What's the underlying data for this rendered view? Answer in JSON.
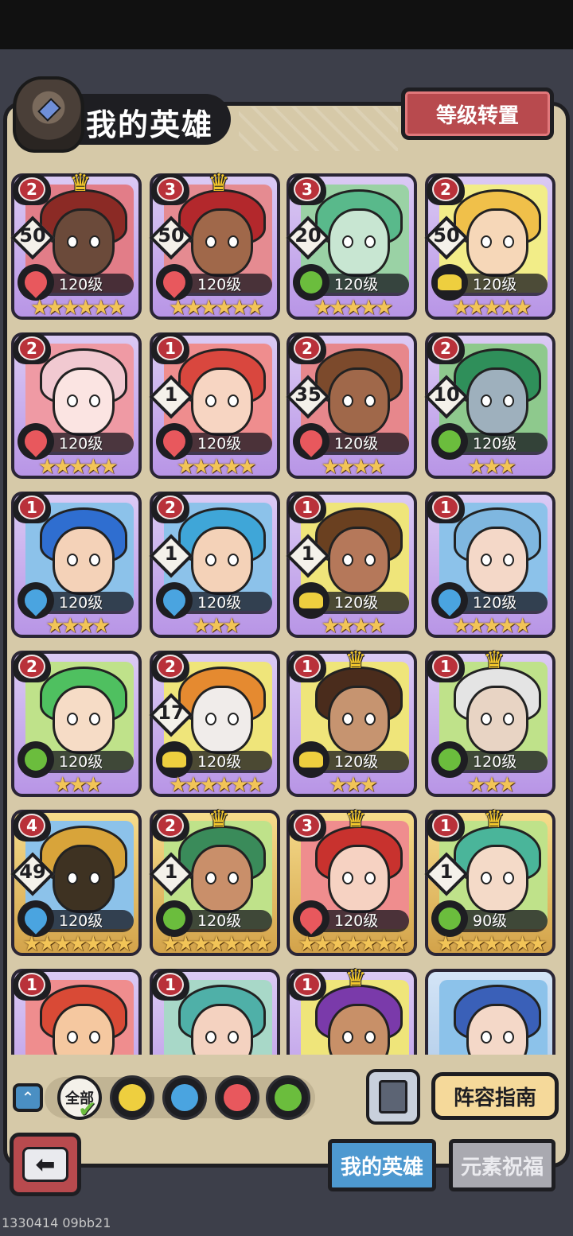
{
  "header": {
    "title": "我的英雄",
    "level_reset": "等级转置"
  },
  "heroes": [
    {
      "rank": "2",
      "crown": true,
      "count": "50",
      "element": "fire",
      "level": "120级",
      "stars": "★★★★★★",
      "frame": "purple",
      "hair": "#8b2a25",
      "skin": "#6b4a3a",
      "bg": "#e27d88"
    },
    {
      "rank": "3",
      "crown": true,
      "count": "50",
      "element": "fire",
      "level": "120级",
      "stars": "★★★★★★",
      "frame": "purple",
      "hair": "#b3282c",
      "skin": "#a0684a",
      "bg": "#e58b91"
    },
    {
      "rank": "3",
      "crown": false,
      "count": "20",
      "element": "wind",
      "level": "120级",
      "stars": "★★★★★",
      "frame": "purple",
      "hair": "#59b98b",
      "skin": "#c8e6d2",
      "bg": "#9ad2a5"
    },
    {
      "rank": "2",
      "crown": false,
      "count": "50",
      "element": "earth",
      "level": "120级",
      "stars": "★★★★★",
      "frame": "purple",
      "hair": "#f0c04a",
      "skin": "#f6d7b8",
      "bg": "#f2ed88"
    },
    {
      "rank": "2",
      "crown": false,
      "count": "",
      "element": "fire",
      "level": "120级",
      "stars": "★★★★★",
      "frame": "purple",
      "hair": "#f1c9d1",
      "skin": "#fbe4e2",
      "bg": "#ef9aa4"
    },
    {
      "rank": "1",
      "crown": false,
      "count": "1",
      "element": "fire",
      "level": "120级",
      "stars": "★★★★★",
      "frame": "purple",
      "hair": "#d9473e",
      "skin": "#f7d5c2",
      "bg": "#ef8d8e"
    },
    {
      "rank": "2",
      "crown": false,
      "count": "35",
      "element": "fire",
      "level": "120级",
      "stars": "★★★★",
      "frame": "purple",
      "hair": "#7c4a2c",
      "skin": "#a0684a",
      "bg": "#e7878c"
    },
    {
      "rank": "2",
      "crown": false,
      "count": "10",
      "element": "wind",
      "level": "120级",
      "stars": "★★★",
      "frame": "purple",
      "hair": "#2f8f5a",
      "skin": "#9eb0bd",
      "bg": "#8ec98d"
    },
    {
      "rank": "1",
      "crown": false,
      "count": "",
      "element": "water",
      "level": "120级",
      "stars": "★★★★",
      "frame": "purple",
      "hair": "#2f6ed0",
      "skin": "#f4d2b8",
      "bg": "#8cc2ea"
    },
    {
      "rank": "2",
      "crown": false,
      "count": "1",
      "element": "water",
      "level": "120级",
      "stars": "★★★",
      "frame": "purple",
      "hair": "#3fa6d8",
      "skin": "#f4d2b8",
      "bg": "#8cc2ea"
    },
    {
      "rank": "1",
      "crown": false,
      "count": "1",
      "element": "earth",
      "level": "120级",
      "stars": "★★★★",
      "frame": "purple",
      "hair": "#6a4020",
      "skin": "#b5785a",
      "bg": "#efe57a"
    },
    {
      "rank": "1",
      "crown": false,
      "count": "",
      "element": "water",
      "level": "120级",
      "stars": "★★★★★",
      "frame": "purple",
      "hair": "#7fb7e0",
      "skin": "#f4d8c8",
      "bg": "#8cc2ea"
    },
    {
      "rank": "2",
      "crown": false,
      "count": "",
      "element": "wind",
      "level": "120级",
      "stars": "★★★",
      "frame": "purple",
      "hair": "#4fc060",
      "skin": "#f6dcc6",
      "bg": "#bfe28a"
    },
    {
      "rank": "2",
      "crown": false,
      "count": "17",
      "element": "earth",
      "level": "120级",
      "stars": "★★★★★★",
      "frame": "purple",
      "hair": "#e58a30",
      "skin": "#f0ecea",
      "bg": "#efe57a"
    },
    {
      "rank": "1",
      "crown": true,
      "count": "",
      "element": "earth",
      "level": "120级",
      "stars": "★★★",
      "frame": "purple",
      "hair": "#4a2c1c",
      "skin": "#c69470",
      "bg": "#efe57a"
    },
    {
      "rank": "1",
      "crown": true,
      "count": "",
      "element": "wind",
      "level": "120级",
      "stars": "★★★",
      "frame": "purple",
      "hair": "#e4e4e4",
      "skin": "#e8d4c4",
      "bg": "#bfe28a"
    },
    {
      "rank": "4",
      "crown": false,
      "count": "49",
      "element": "water",
      "level": "120级",
      "stars": "★★★★★★★",
      "frame": "gold",
      "hair": "#d8a43a",
      "skin": "#3e3222",
      "bg": "#8cc2ea"
    },
    {
      "rank": "2",
      "crown": true,
      "count": "1",
      "element": "wind",
      "level": "120级",
      "stars": "★★★★★★★",
      "frame": "gold",
      "hair": "#3a8b5a",
      "skin": "#c98f6a",
      "bg": "#bfe28a"
    },
    {
      "rank": "3",
      "crown": true,
      "count": "",
      "element": "fire",
      "level": "120级",
      "stars": "★★★★★★★",
      "frame": "gold",
      "hair": "#c8322e",
      "skin": "#f6d2c2",
      "bg": "#ef8d8e"
    },
    {
      "rank": "1",
      "crown": true,
      "count": "1",
      "element": "wind",
      "level": "90级",
      "stars": "★★★★★★★",
      "frame": "gold",
      "hair": "#4ab59a",
      "skin": "#f4dac8",
      "bg": "#bfe28a"
    },
    {
      "rank": "1",
      "crown": false,
      "count": "",
      "element": "fire",
      "level": "",
      "stars": "",
      "frame": "purple",
      "hair": "#d94a36",
      "skin": "#f5c8a0",
      "bg": "#ef8d8e"
    },
    {
      "rank": "1",
      "crown": false,
      "count": "",
      "element": "wind",
      "level": "",
      "stars": "",
      "frame": "purple",
      "hair": "#4fb0a8",
      "skin": "#f4d2c0",
      "bg": "#a8d8c8"
    },
    {
      "rank": "1",
      "crown": true,
      "count": "",
      "element": "earth",
      "level": "",
      "stars": "",
      "frame": "purple",
      "hair": "#7a3aaa",
      "skin": "#c89068",
      "bg": "#efe57a"
    },
    {
      "rank": "",
      "crown": false,
      "count": "",
      "element": "water",
      "level": "",
      "stars": "",
      "frame": "blue",
      "hair": "#3a60b8",
      "skin": "#f4d8c8",
      "bg": "#8cc2ea"
    }
  ],
  "filters": {
    "all": "全部",
    "elements": [
      "earth",
      "water",
      "fire",
      "wind"
    ]
  },
  "element_colors": {
    "fire": "#e8585d",
    "wind": "#6bbd3d",
    "earth": "#eecf3f",
    "water": "#4aa4e0"
  },
  "buttons": {
    "lineup_guide": "阵容指南"
  },
  "tabs": {
    "my_heroes": "我的英雄",
    "element_blessing": "元素祝福"
  },
  "build_id": "1330414 09bb21"
}
